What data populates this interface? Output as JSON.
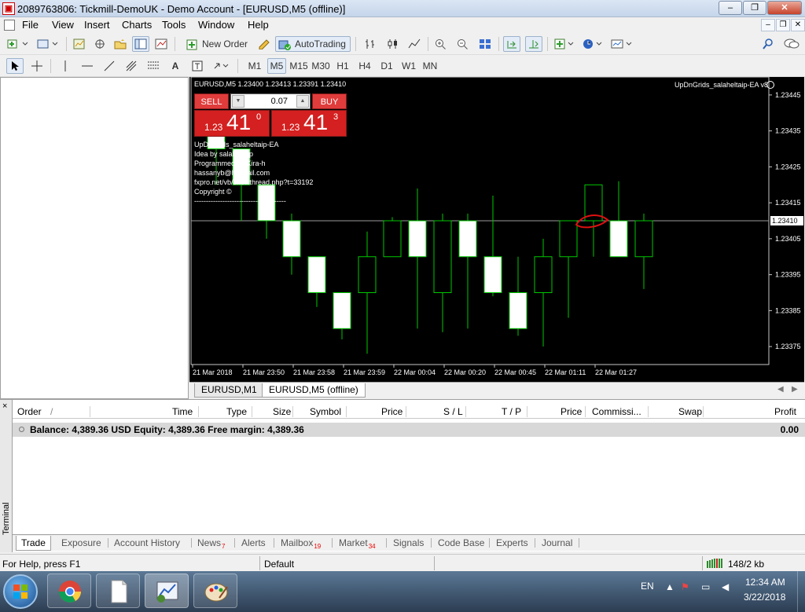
{
  "window": {
    "title": "2089763806: Tickmill-DemoUK - Demo Account - [EURUSD,M5 (offline)]",
    "controls": {
      "minimize": "–",
      "restore": "❐",
      "close": "✕"
    },
    "mdi": {
      "minimize": "–",
      "restore": "❐",
      "close": "✕"
    }
  },
  "menu": [
    "File",
    "View",
    "Insert",
    "Charts",
    "Tools",
    "Window",
    "Help"
  ],
  "toolbar": {
    "new_order": "New Order",
    "auto_trading": "AutoTrading"
  },
  "timeframes": [
    "M1",
    "M5",
    "M15",
    "M30",
    "H1",
    "H4",
    "D1",
    "W1",
    "MN"
  ],
  "active_timeframe": "M5",
  "text_tool": "A",
  "chart": {
    "header": "EURUSD,M5  1.23400 1.23413 1.23391 1.23410",
    "ea_name": "UpDnGrids_salaheltaip-EA v8",
    "one_click": {
      "sell": "SELL",
      "buy": "BUY",
      "lot": "0.07",
      "sell_small": "1.23",
      "sell_big": "41",
      "sell_sup": "0",
      "buy_small": "1.23",
      "buy_big": "41",
      "buy_sup": "3"
    },
    "ea_info": [
      "UpDnGrids_salaheltaip-EA",
      "Idea by salaheltaip",
      "Programmed by Kira-h",
      "hassanyb@hotmail.com",
      "fxpro.net/vb/showthread.php?t=33192",
      "Copyright ©",
      "---------------------------------------"
    ]
  },
  "chart_data": {
    "type": "candlestick",
    "symbol": "EURUSD",
    "timeframe": "M5",
    "background": "#000000",
    "bull_color": "#00c800",
    "bear_fill": "#ffffff",
    "ylim": [
      1.2337,
      1.2345
    ],
    "y_ticks": [
      "1.23445",
      "1.23435",
      "1.23425",
      "1.23415",
      "1.23405",
      "1.23395",
      "1.23385",
      "1.23375"
    ],
    "x_ticks": [
      "21 Mar 2018",
      "21 Mar 23:50",
      "21 Mar 23:58",
      "21 Mar 23:59",
      "22 Mar 00:04",
      "22 Mar 00:20",
      "22 Mar 00:45",
      "22 Mar 01:11",
      "22 Mar 01:27"
    ],
    "current_price": "1.23410",
    "candles": [
      {
        "o": 1.2344,
        "h": 1.2344,
        "l": 1.2342,
        "c": 1.2343
      },
      {
        "o": 1.2343,
        "h": 1.2343,
        "l": 1.2341,
        "c": 1.2342
      },
      {
        "o": 1.2342,
        "h": 1.2342,
        "l": 1.23405,
        "c": 1.2341
      },
      {
        "o": 1.2341,
        "h": 1.23412,
        "l": 1.23395,
        "c": 1.234
      },
      {
        "o": 1.234,
        "h": 1.234,
        "l": 1.23386,
        "c": 1.2339
      },
      {
        "o": 1.2339,
        "h": 1.2339,
        "l": 1.23377,
        "c": 1.2338
      },
      {
        "o": 1.2339,
        "h": 1.23407,
        "l": 1.23373,
        "c": 1.234
      },
      {
        "o": 1.234,
        "h": 1.23411,
        "l": 1.234,
        "c": 1.2341
      },
      {
        "o": 1.2341,
        "h": 1.23419,
        "l": 1.2338,
        "c": 1.234
      },
      {
        "o": 1.2339,
        "h": 1.23412,
        "l": 1.23379,
        "c": 1.2341
      },
      {
        "o": 1.2341,
        "h": 1.23412,
        "l": 1.2338,
        "c": 1.234
      },
      {
        "o": 1.234,
        "h": 1.23417,
        "l": 1.23389,
        "c": 1.2339
      },
      {
        "o": 1.2339,
        "h": 1.234,
        "l": 1.23378,
        "c": 1.2338
      },
      {
        "o": 1.2339,
        "h": 1.23405,
        "l": 1.23375,
        "c": 1.234
      },
      {
        "o": 1.234,
        "h": 1.2341,
        "l": 1.23383,
        "c": 1.2341
      },
      {
        "o": 1.2341,
        "h": 1.2342,
        "l": 1.234,
        "c": 1.2342
      },
      {
        "o": 1.2341,
        "h": 1.23421,
        "l": 1.234,
        "c": 1.234
      },
      {
        "o": 1.234,
        "h": 1.23412,
        "l": 1.23391,
        "c": 1.2341
      }
    ]
  },
  "chart_tabs": [
    "EURUSD,M1",
    "EURUSD,M5 (offline)"
  ],
  "active_chart_tab": 1,
  "terminal": {
    "label": "Terminal",
    "close": "×",
    "columns": [
      "Order",
      "/",
      "Time",
      "Type",
      "Size",
      "Symbol",
      "Price",
      "S / L",
      "T / P",
      "Price",
      "Commissi...",
      "Swap",
      "Profit"
    ],
    "balance_row": "Balance: 4,389.36 USD  Equity: 4,389.36  Free margin: 4,389.36",
    "profit": "0.00",
    "tabs": [
      {
        "label": "Trade",
        "badge": ""
      },
      {
        "label": "Exposure",
        "badge": ""
      },
      {
        "label": "Account History",
        "badge": ""
      },
      {
        "label": "News",
        "badge": "7"
      },
      {
        "label": "Alerts",
        "badge": ""
      },
      {
        "label": "Mailbox",
        "badge": "19"
      },
      {
        "label": "Market",
        "badge": "34"
      },
      {
        "label": "Signals",
        "badge": ""
      },
      {
        "label": "Code Base",
        "badge": ""
      },
      {
        "label": "Experts",
        "badge": ""
      },
      {
        "label": "Journal",
        "badge": ""
      }
    ]
  },
  "status": {
    "help": "For Help, press F1",
    "profile": "Default",
    "traffic": "148/2 kb"
  },
  "taskbar": {
    "lang": "EN",
    "time": "12:34 AM",
    "date": "3/22/2018"
  }
}
